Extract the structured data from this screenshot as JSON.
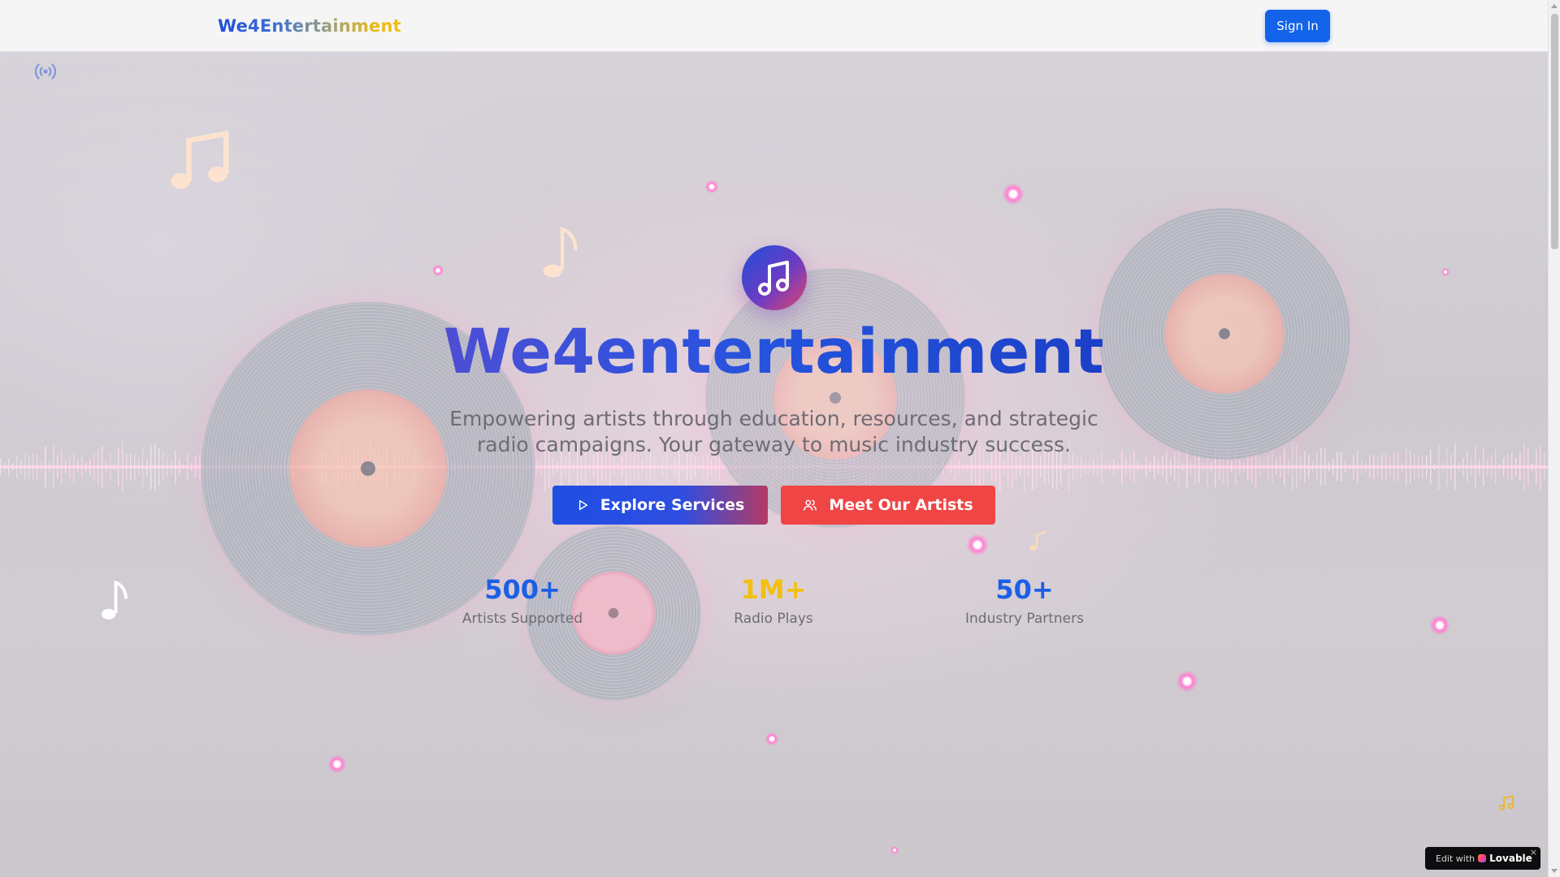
{
  "header": {
    "logo": "We4Entertainment",
    "sign_in_label": "Sign In"
  },
  "hero": {
    "icon": "music-note-icon",
    "title": "We4entertainment",
    "subtitle_line1": "Empowering artists through education, resources, and strategic",
    "subtitle_line2": "radio campaigns. Your gateway to music industry success.",
    "buttons": {
      "explore": {
        "label": "Explore Services",
        "icon": "play-icon"
      },
      "artists": {
        "label": "Meet Our Artists",
        "icon": "users-icon"
      }
    }
  },
  "stats": [
    {
      "value": "500+",
      "label": "Artists Supported",
      "color": "#1d5fe6"
    },
    {
      "value": "1M+",
      "label": "Radio Plays",
      "color": "#f2c011"
    },
    {
      "value": "50+",
      "label": "Industry Partners",
      "color": "#1d5fe6"
    }
  ],
  "decorations": {
    "top_left_icon": "radio-broadcast-icon",
    "bottom_right_icon": "music-note-icon"
  },
  "badge": {
    "prefix": "Edit with",
    "brand": "Lovable",
    "close": "×"
  },
  "colors": {
    "primary": "#1262ea",
    "accent_red": "#ef4545",
    "accent_gold": "#f2c011"
  }
}
